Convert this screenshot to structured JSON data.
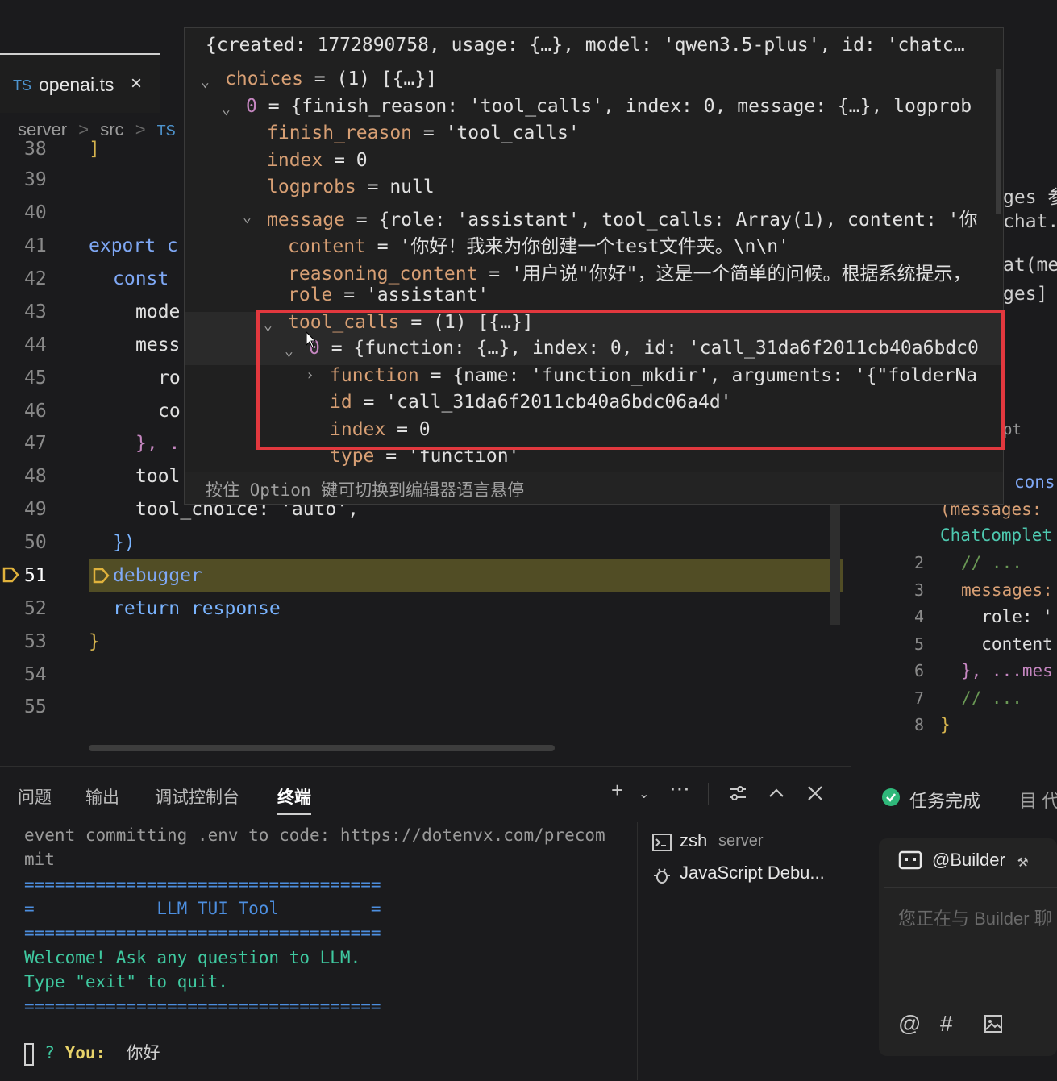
{
  "tab": {
    "lang_badge": "TS",
    "file_name": "openai.ts",
    "close_glyph": "×"
  },
  "breadcrumb": {
    "part1": "server",
    "sep1": ">",
    "part2": "src",
    "sep2": ">",
    "part3": "TS"
  },
  "editor": {
    "partial_line": "38",
    "lines": [
      {
        "n": "39",
        "code": ""
      },
      {
        "n": "40",
        "code": ""
      },
      {
        "n": "41",
        "code": "export c"
      },
      {
        "n": "42",
        "code": "const"
      },
      {
        "n": "43",
        "code": "mode"
      },
      {
        "n": "44",
        "code": "mess"
      },
      {
        "n": "45",
        "code": "ro"
      },
      {
        "n": "46",
        "code": "co"
      },
      {
        "n": "47",
        "code": "}, ."
      },
      {
        "n": "48",
        "code": "tool"
      },
      {
        "n": "49",
        "code": "tool_choice: 'auto',"
      },
      {
        "n": "50",
        "code": "})"
      },
      {
        "n": "51",
        "code": "debugger"
      },
      {
        "n": "52",
        "code": "return response"
      },
      {
        "n": "53",
        "code": "}"
      },
      {
        "n": "54",
        "code": ""
      },
      {
        "n": "55",
        "code": ""
      }
    ]
  },
  "hover": {
    "header": "{created: 1772890758, usage: {…}, model: 'qwen3.5-plus', id: 'chatc…",
    "rows": [
      {
        "key": "choices",
        "value": " = (1) [{…}]"
      },
      {
        "key": "0",
        "value": " = {finish_reason: 'tool_calls', index: 0, message: {…}, logprob"
      },
      {
        "key": "finish_reason",
        "value": " = 'tool_calls'"
      },
      {
        "key": "index",
        "value": " = 0"
      },
      {
        "key": "logprobs",
        "value": " = null"
      },
      {
        "key": "message",
        "value": " = {role: 'assistant', tool_calls: Array(1), content: '你"
      },
      {
        "key": "content",
        "value": " = '你好！我来为你创建一个test文件夹。\\n\\n'"
      },
      {
        "key": "reasoning_content",
        "value": " = '用户说\"你好\"，这是一个简单的问候。根据系统提示，"
      },
      {
        "key": "role",
        "value": " = 'assistant'"
      },
      {
        "key": "tool_calls",
        "value": " = (1) [{…}]"
      },
      {
        "key": "0",
        "value": " = {function: {…}, index: 0, id: 'call_31da6f2011cb40a6bdc0"
      },
      {
        "key": "function",
        "value": " = {name: 'function_mkdir', arguments: '{\"folderNa"
      },
      {
        "key": "id",
        "value": " = 'call_31da6f2011cb40a6bdc06a4d'"
      },
      {
        "key": "index",
        "value": " = 0"
      },
      {
        "key": "type",
        "value": " = 'function'"
      }
    ],
    "footer": "按住 Option 键可切换到编辑器语言悬停"
  },
  "right_peek": {
    "top_fragments": [
      "ges 参",
      "chat.",
      "at(me",
      "ges]",
      "pt"
    ],
    "cons": "cons",
    "messages_label": "(messages:",
    "type_label": "ChatComplet",
    "lines": [
      {
        "n": "2",
        "code": "// ..."
      },
      {
        "n": "3",
        "code": "messages:"
      },
      {
        "n": "4",
        "code": "  role: '"
      },
      {
        "n": "5",
        "code": "  content"
      },
      {
        "n": "6",
        "code": "}, ...mes"
      },
      {
        "n": "7",
        "code": "// ..."
      },
      {
        "n": "8",
        "code": "}"
      }
    ]
  },
  "panel": {
    "tabs": [
      "问题",
      "输出",
      "调试控制台",
      "终端"
    ],
    "active_tab": "终端",
    "terminal_lines": [
      "event committing .env to code: https://dotenvx.com/precom",
      "mit",
      "===================================",
      "=            LLM TUI Tool         =",
      "===================================",
      "Welcome! Ask any question to LLM.",
      "Type \"exit\" to quit.",
      "==================================="
    ],
    "prompt_mark": "?",
    "prompt_label": "You:",
    "prompt_value": "你好",
    "terminals": [
      {
        "name": "zsh",
        "detail": "server"
      },
      {
        "name": "JavaScript Debu...",
        "detail": ""
      }
    ]
  },
  "chat": {
    "status": "任务完成",
    "status_extra": "目 代",
    "agent": "@Builder",
    "placeholder": "您正在与 Builder 聊",
    "actions": [
      "@",
      "#"
    ]
  }
}
